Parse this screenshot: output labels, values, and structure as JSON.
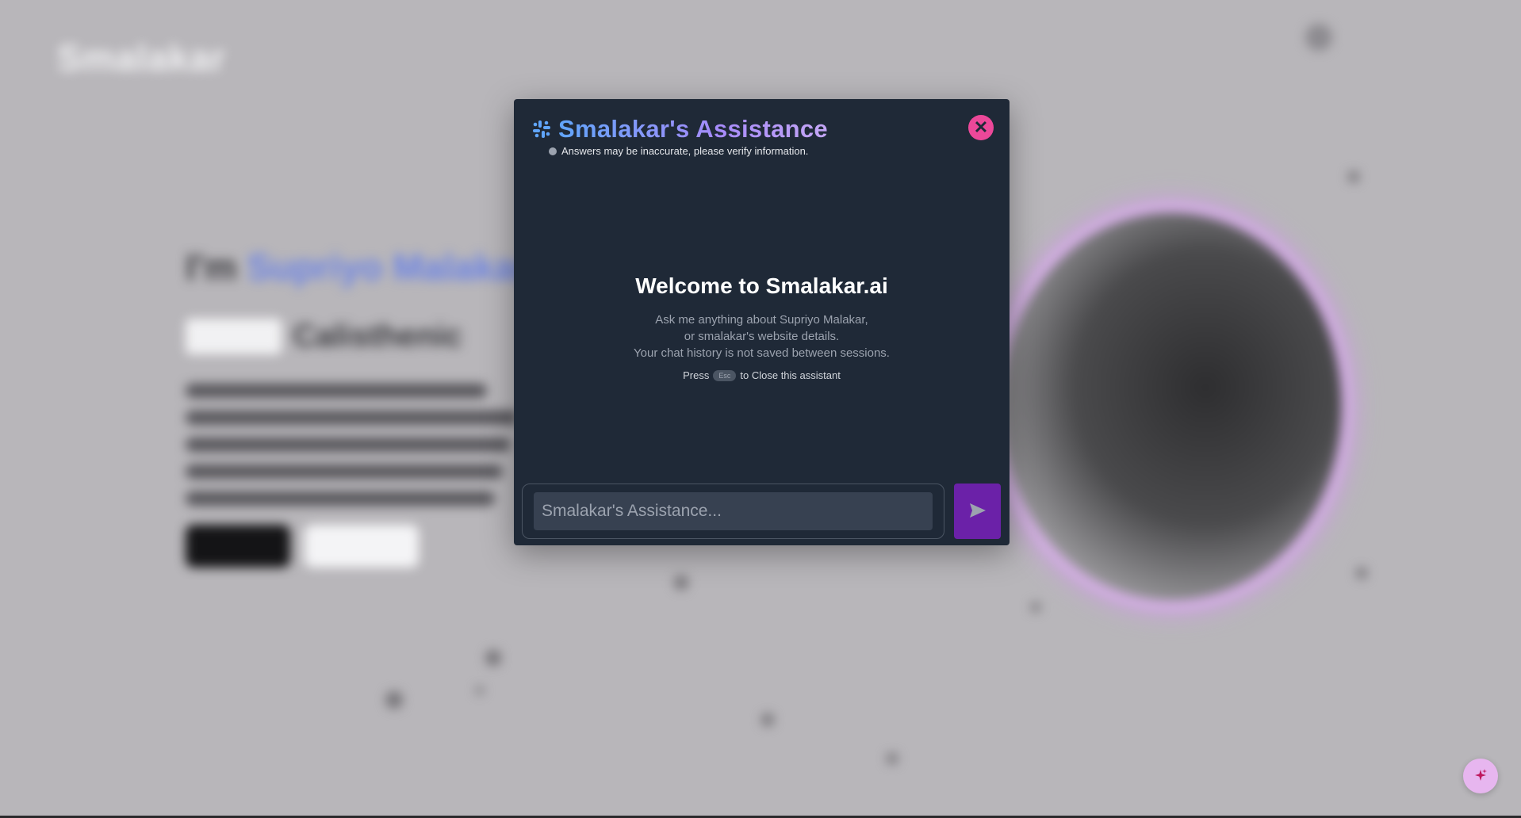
{
  "background": {
    "logo": "Smalakar",
    "hero_prefix": "I'm ",
    "hero_name": "Supriyo Malakar",
    "subtitle": "Calisthenic"
  },
  "modal": {
    "title": "Smalakar's Assistance",
    "title_icon": "slack-hash-icon",
    "disclaimer": "Answers may be inaccurate, please verify information.",
    "close_icon": "close-icon",
    "welcome": {
      "title": "Welcome to Smalakar.ai",
      "line1": "Ask me anything about Supriyo Malakar,",
      "line2": "or smalakar's website details.",
      "line3": "Your chat history is not saved between sessions.",
      "esc_prefix": "Press",
      "esc_key": "Esc",
      "esc_suffix": "to Close this assistant"
    },
    "input": {
      "placeholder": "Smalakar's Assistance...",
      "value": ""
    },
    "send_icon": "send-icon"
  },
  "fab": {
    "icon": "sparkles-icon"
  },
  "colors": {
    "modal_bg": "#1f2937",
    "close_button": "#ec4899",
    "send_button": "#6b21a8",
    "title_gradient_start": "#60a5fa",
    "title_gradient_end": "#c4a6f5"
  }
}
